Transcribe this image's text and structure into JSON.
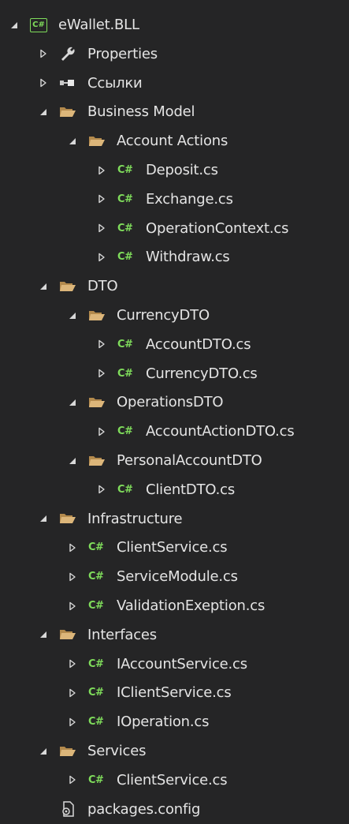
{
  "solution_explorer": {
    "colors": {
      "background": "#252526",
      "text": "#e4e4e4",
      "csharp_badge": "#7fdc5b",
      "folder": "#dcb67a",
      "arrow": "#d8d8d8"
    },
    "badges": {
      "project": "C#",
      "csharp_file": "C#"
    },
    "items": [
      {
        "label": "eWallet.BLL",
        "icon": "csharp-project-icon",
        "state": "expanded",
        "depth": 0
      },
      {
        "label": "Properties",
        "icon": "wrench-icon",
        "state": "collapsed",
        "depth": 1
      },
      {
        "label": "Ссылки",
        "icon": "references-icon",
        "state": "collapsed",
        "depth": 1
      },
      {
        "label": "Business Model",
        "icon": "folder-open-icon",
        "state": "expanded",
        "depth": 1
      },
      {
        "label": "Account Actions",
        "icon": "folder-open-icon",
        "state": "expanded",
        "depth": 2
      },
      {
        "label": "Deposit.cs",
        "icon": "csharp-file-icon",
        "state": "collapsed",
        "depth": 3
      },
      {
        "label": "Exchange.cs",
        "icon": "csharp-file-icon",
        "state": "collapsed",
        "depth": 3
      },
      {
        "label": "OperationContext.cs",
        "icon": "csharp-file-icon",
        "state": "collapsed",
        "depth": 3
      },
      {
        "label": "Withdraw.cs",
        "icon": "csharp-file-icon",
        "state": "collapsed",
        "depth": 3
      },
      {
        "label": "DTO",
        "icon": "folder-open-icon",
        "state": "expanded",
        "depth": 1
      },
      {
        "label": "CurrencyDTO",
        "icon": "folder-open-icon",
        "state": "expanded",
        "depth": 2
      },
      {
        "label": "AccountDTO.cs",
        "icon": "csharp-file-icon",
        "state": "collapsed",
        "depth": 3
      },
      {
        "label": "CurrencyDTO.cs",
        "icon": "csharp-file-icon",
        "state": "collapsed",
        "depth": 3
      },
      {
        "label": "OperationsDTO",
        "icon": "folder-open-icon",
        "state": "expanded",
        "depth": 2
      },
      {
        "label": "AccountActionDTO.cs",
        "icon": "csharp-file-icon",
        "state": "collapsed",
        "depth": 3
      },
      {
        "label": "PersonalAccountDTO",
        "icon": "folder-open-icon",
        "state": "expanded",
        "depth": 2
      },
      {
        "label": "ClientDTO.cs",
        "icon": "csharp-file-icon",
        "state": "collapsed",
        "depth": 3
      },
      {
        "label": "Infrastructure",
        "icon": "folder-open-icon",
        "state": "expanded",
        "depth": 1
      },
      {
        "label": "ClientService.cs",
        "icon": "csharp-file-icon",
        "state": "collapsed",
        "depth": 2
      },
      {
        "label": "ServiceModule.cs",
        "icon": "csharp-file-icon",
        "state": "collapsed",
        "depth": 2
      },
      {
        "label": "ValidationExeption.cs",
        "icon": "csharp-file-icon",
        "state": "collapsed",
        "depth": 2
      },
      {
        "label": "Interfaces",
        "icon": "folder-open-icon",
        "state": "expanded",
        "depth": 1
      },
      {
        "label": "IAccountService.cs",
        "icon": "csharp-file-icon",
        "state": "collapsed",
        "depth": 2
      },
      {
        "label": "IClientService.cs",
        "icon": "csharp-file-icon",
        "state": "collapsed",
        "depth": 2
      },
      {
        "label": "IOperation.cs",
        "icon": "csharp-file-icon",
        "state": "collapsed",
        "depth": 2
      },
      {
        "label": "Services",
        "icon": "folder-open-icon",
        "state": "expanded",
        "depth": 1
      },
      {
        "label": "ClientService.cs",
        "icon": "csharp-file-icon",
        "state": "collapsed",
        "depth": 2
      },
      {
        "label": "packages.config",
        "icon": "config-file-icon",
        "state": "none",
        "depth": 1
      }
    ]
  }
}
